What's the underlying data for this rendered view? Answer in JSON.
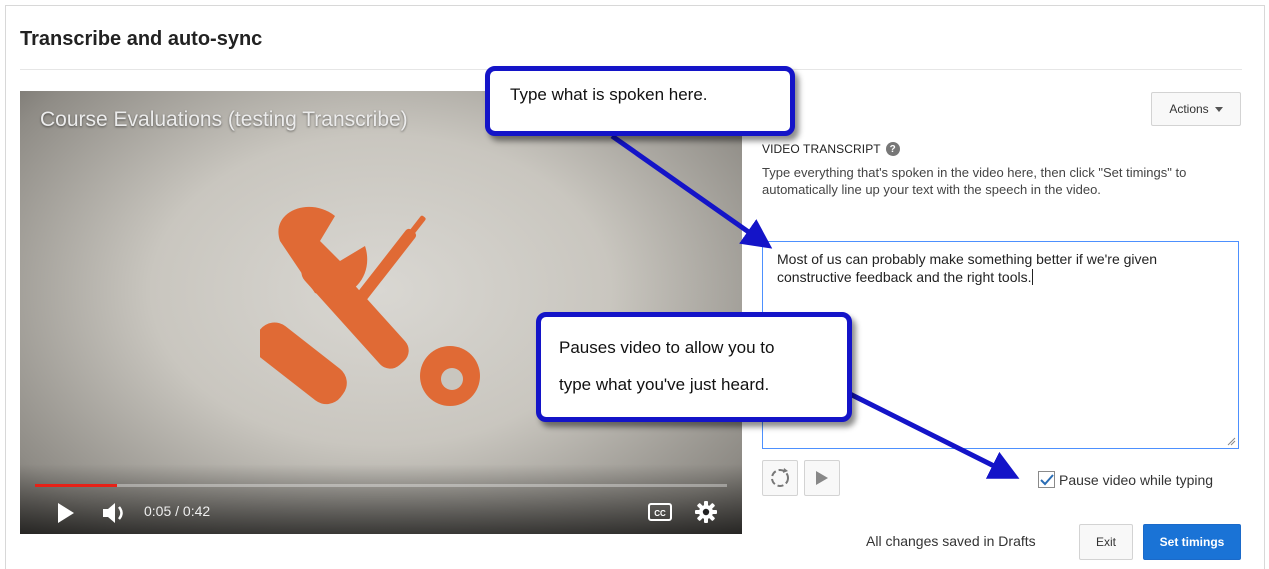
{
  "page": {
    "title": "Transcribe and auto-sync"
  },
  "player": {
    "video_title": "Course Evaluations (testing Transcribe)",
    "time_readout": "0:05 / 0:42",
    "progress": 0.119,
    "play_icon": "play-icon",
    "volume_icon": "volume-icon",
    "captions_icon": "closed-captions-icon",
    "settings_icon": "gear-icon",
    "progress_color": "#e62117"
  },
  "actions": {
    "label": "Actions"
  },
  "transcript": {
    "label": "VIDEO TRANSCRIPT",
    "instructions": "Type everything that's spoken in the video here, then click \"Set timings\" to automatically line up your text with the speech in the video.",
    "value": "Most of us can probably make something better if we're given constructive feedback and the right tools."
  },
  "controls": {
    "replay_icon": "replay-icon",
    "play_icon": "play-icon",
    "pause_while_typing": {
      "label": "Pause video while typing",
      "checked": true
    }
  },
  "footer": {
    "status": "All changes saved in Drafts",
    "exit_label": "Exit",
    "set_timings_label": "Set timings"
  },
  "callouts": {
    "type_here": "Type what is spoken here.",
    "pause_line1": "Pauses video to allow you to",
    "pause_line2": "type what you've just heard."
  },
  "colors": {
    "accent": "#1a73d6",
    "callout_border": "#1414c8",
    "illustration": "#e06a35"
  }
}
